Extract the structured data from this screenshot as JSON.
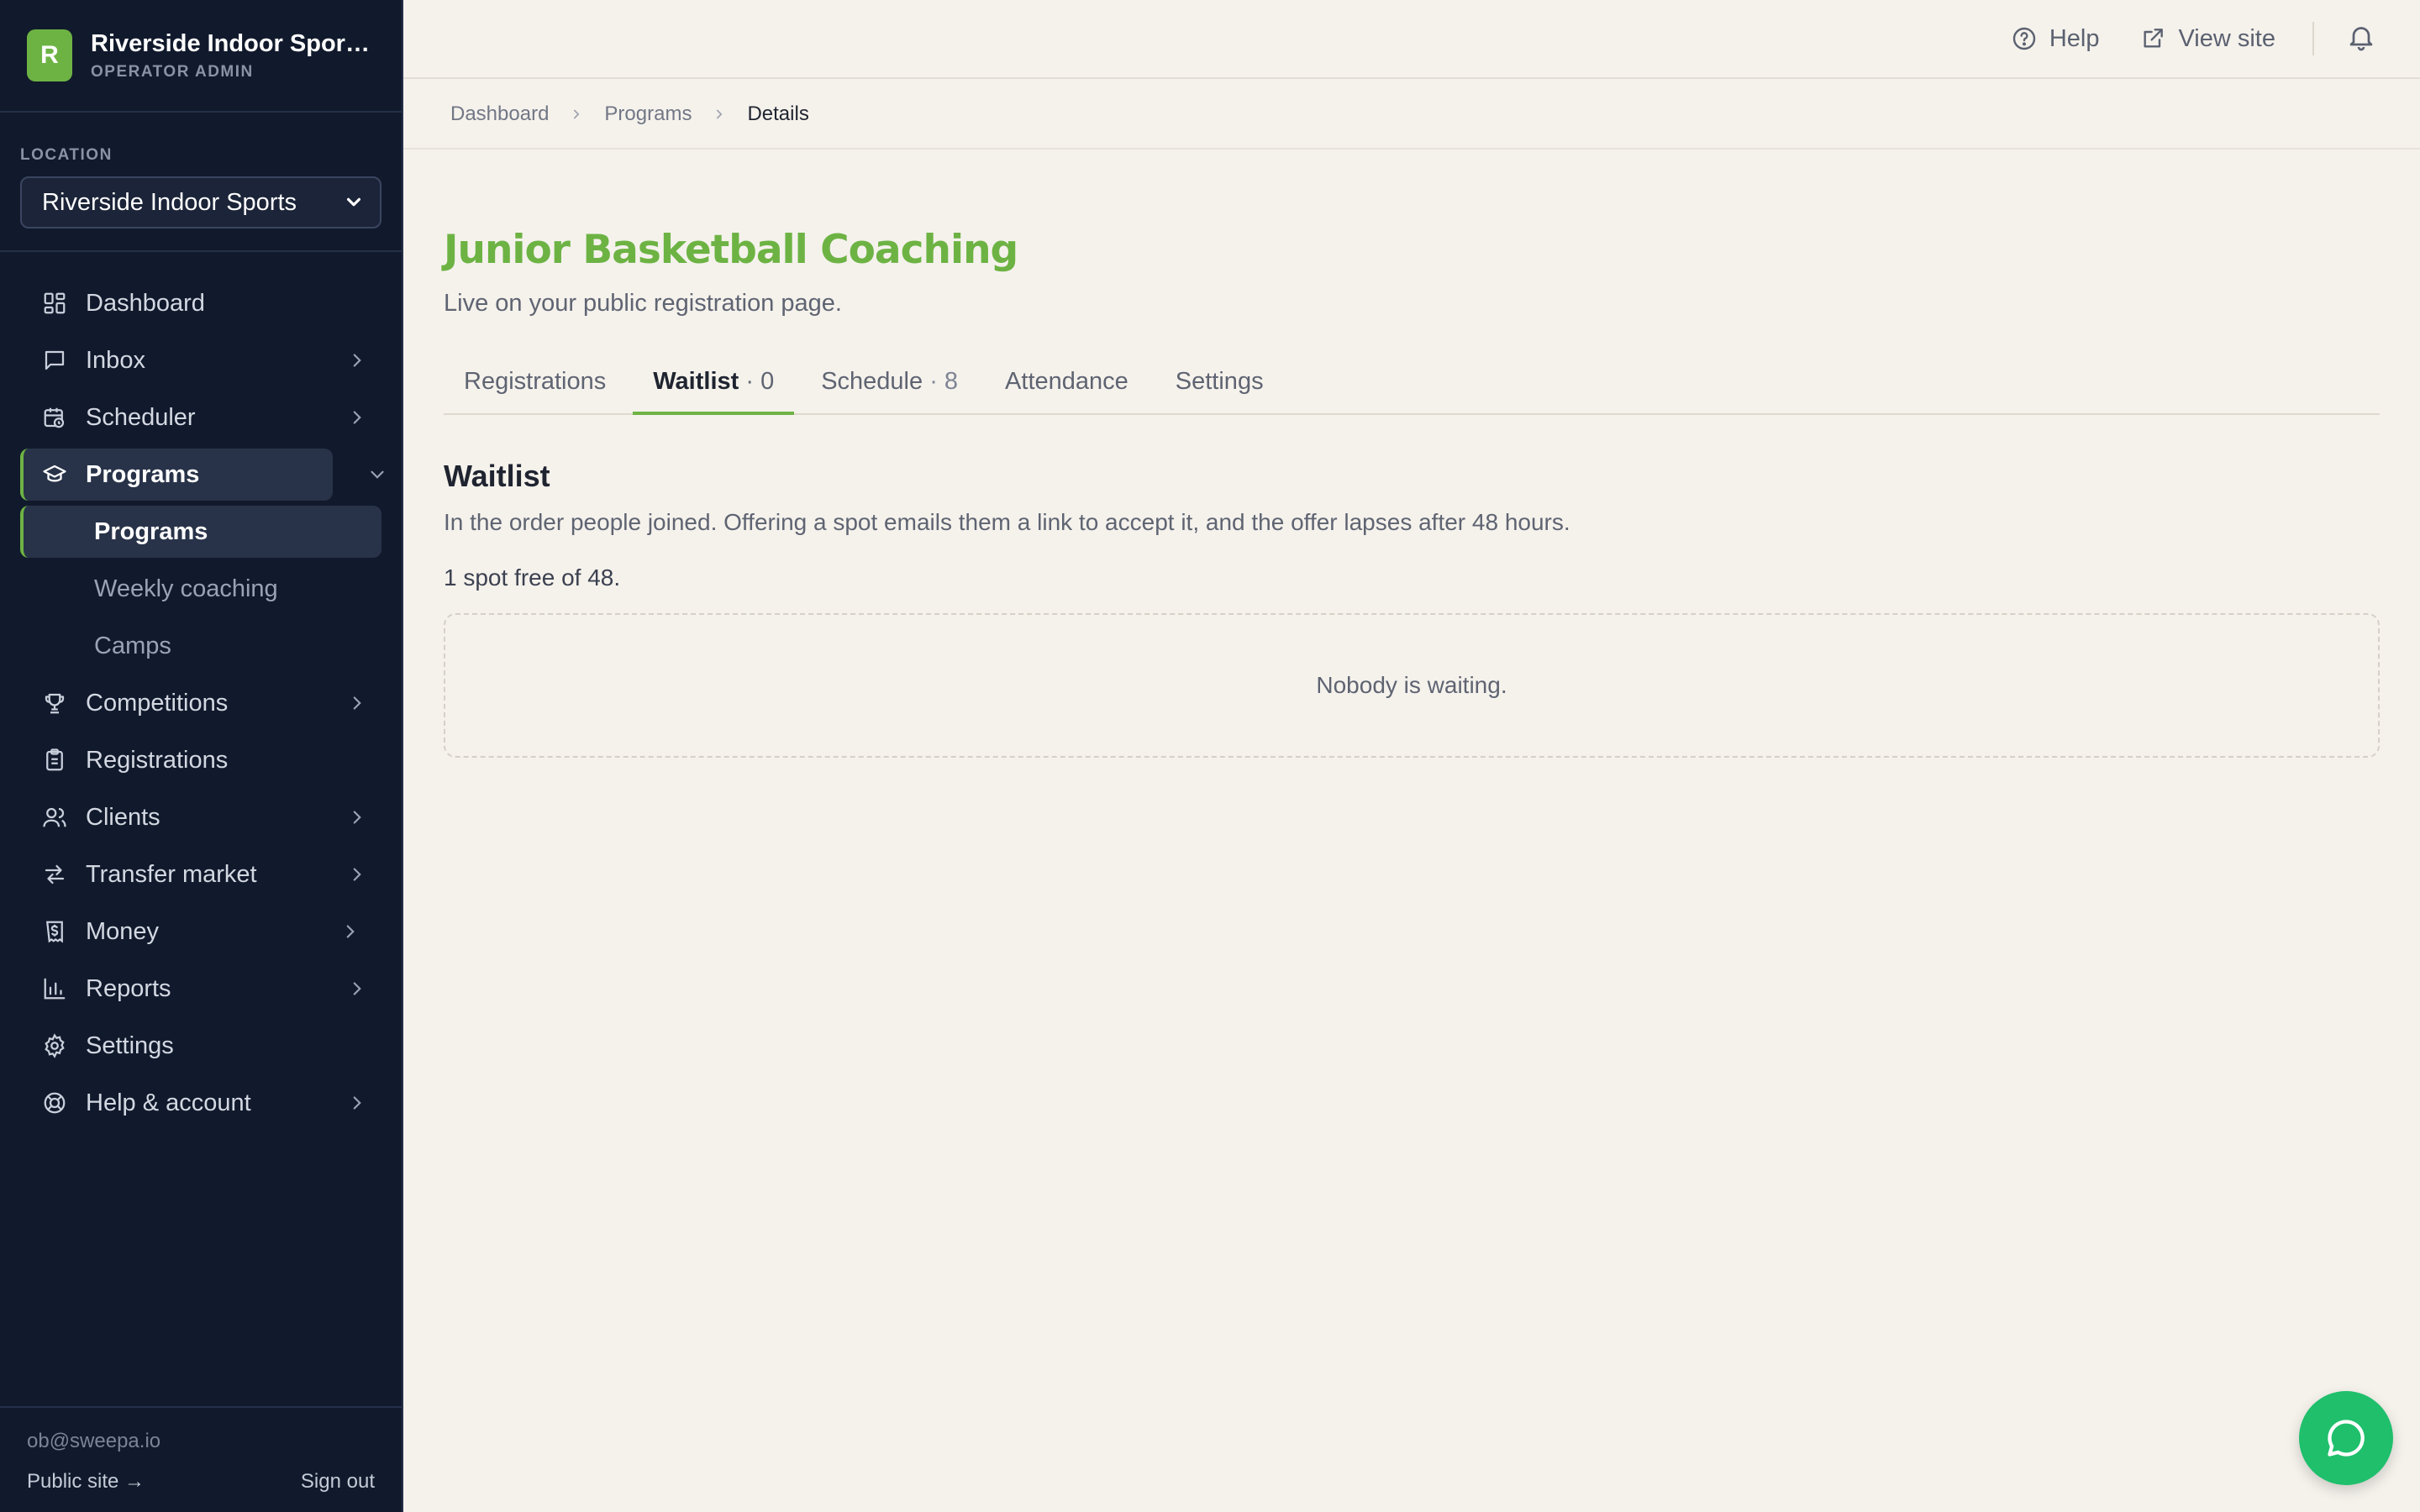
{
  "brand": {
    "logo_letter": "R",
    "name": "Riverside Indoor Sports Centre",
    "subtitle": "OPERATOR ADMIN",
    "color": "#6db344"
  },
  "location": {
    "label": "LOCATION",
    "selected": "Riverside Indoor Sports"
  },
  "nav": {
    "dashboard": "Dashboard",
    "inbox": "Inbox",
    "scheduler": "Scheduler",
    "programs": "Programs",
    "programs_sub": [
      "Programs",
      "Weekly coaching",
      "Camps"
    ],
    "competitions": "Competitions",
    "registrations": "Registrations",
    "clients": "Clients",
    "transfer_market": "Transfer market",
    "money": "Money",
    "reports": "Reports",
    "settings": "Settings",
    "help_account": "Help & account"
  },
  "footer": {
    "email": "ob@sweepa.io",
    "public_site": "Public site →",
    "sign_out": "Sign out"
  },
  "topbar": {
    "help": "Help",
    "view_site": "View site"
  },
  "breadcrumb": [
    "Dashboard",
    "Programs",
    "Details"
  ],
  "page": {
    "title": "Junior Basketball Coaching",
    "subtitle": "Live on your public registration page."
  },
  "tabs": [
    {
      "label": "Registrations",
      "count": ""
    },
    {
      "label": "Waitlist",
      "count": "· 0"
    },
    {
      "label": "Schedule",
      "count": "· 8"
    },
    {
      "label": "Attendance",
      "count": ""
    },
    {
      "label": "Settings",
      "count": ""
    }
  ],
  "waitlist": {
    "title": "Waitlist",
    "description": "In the order people joined. Offering a spot emails them a link to accept it, and the offer lapses after 48 hours.",
    "spots": "1 spot free of 48.",
    "empty": "Nobody is waiting."
  },
  "colors": {
    "sidebar_bg": "#111a2c",
    "accent": "#6db344",
    "chat": "#1fbf6c"
  }
}
